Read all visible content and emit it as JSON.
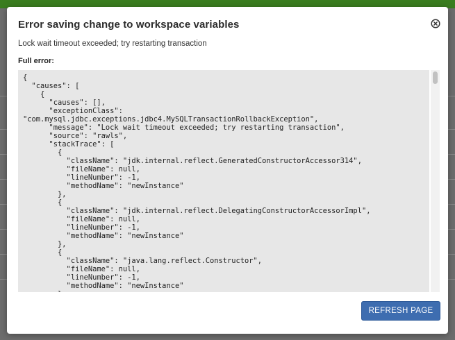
{
  "colors": {
    "backdrop": "#6d6d6d",
    "topbar": "#3a7d1f",
    "error_box_bg": "#e7e7e7",
    "button_bg": "#3e6db0",
    "button_text": "#ffffff"
  },
  "modal": {
    "title": "Error saving change to workspace variables",
    "close_icon": "close-circle-icon",
    "message": "Lock wait timeout exceeded; try restarting transaction",
    "full_error_label": "Full error:",
    "error_text": "{\n  \"causes\": [\n    {\n      \"causes\": [],\n      \"exceptionClass\":\n\"com.mysql.jdbc.exceptions.jdbc4.MySQLTransactionRollbackException\",\n      \"message\": \"Lock wait timeout exceeded; try restarting transaction\",\n      \"source\": \"rawls\",\n      \"stackTrace\": [\n        {\n          \"className\": \"jdk.internal.reflect.GeneratedConstructorAccessor314\",\n          \"fileName\": null,\n          \"lineNumber\": -1,\n          \"methodName\": \"newInstance\"\n        },\n        {\n          \"className\": \"jdk.internal.reflect.DelegatingConstructorAccessorImpl\",\n          \"fileName\": null,\n          \"lineNumber\": -1,\n          \"methodName\": \"newInstance\"\n        },\n        {\n          \"className\": \"java.lang.reflect.Constructor\",\n          \"fileName\": null,\n          \"lineNumber\": -1,\n          \"methodName\": \"newInstance\"\n        },",
    "refresh_button_label": "REFRESH PAGE"
  }
}
